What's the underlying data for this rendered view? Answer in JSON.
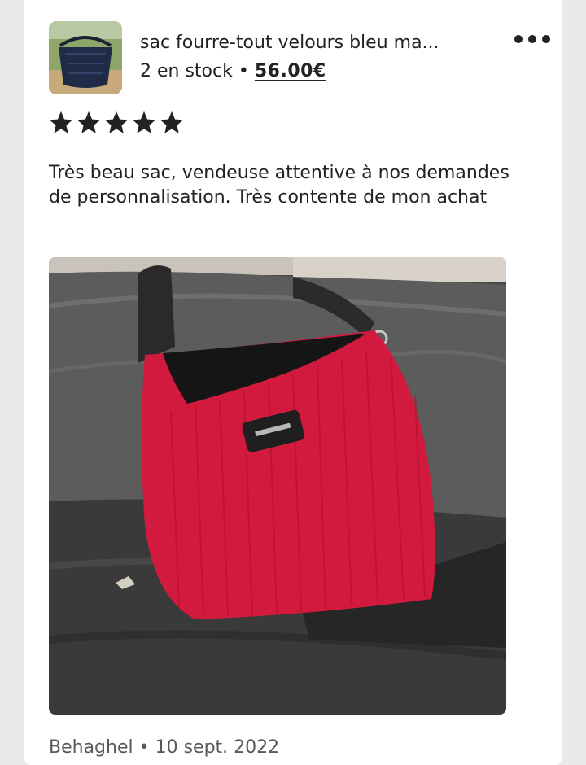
{
  "listing": {
    "title": "sac fourre-tout velours bleu ma...",
    "stock": "2 en stock",
    "separator": "•",
    "price": "56.00€",
    "more_icon": "more-horizontal-icon"
  },
  "review": {
    "rating": 5,
    "max_rating": 5,
    "star_icon": "star-filled-icon",
    "text": "Très beau sac, vendeuse attentive à nos demandes de personnalisation. Très contente de mon achat",
    "reviewer": "Behaghel",
    "date_separator": "•",
    "date": "10 sept. 2022"
  },
  "colors": {
    "background": "#e9e9e9",
    "card": "#ffffff",
    "text": "#222222",
    "muted": "#595959",
    "bag_red": "#d11a3e"
  }
}
